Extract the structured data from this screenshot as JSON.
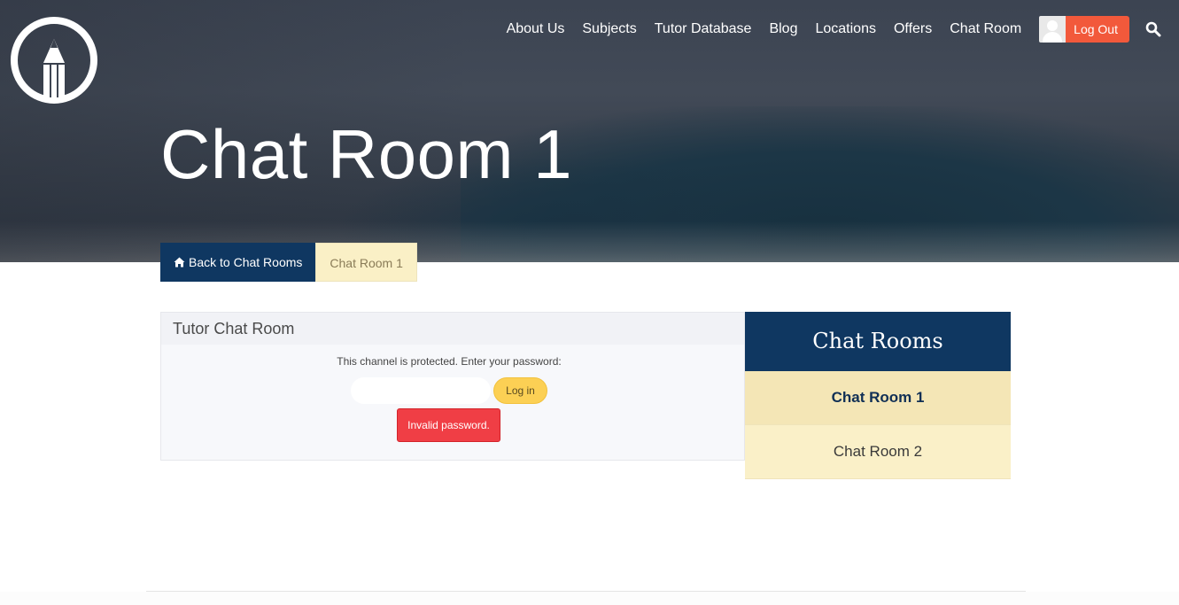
{
  "nav": {
    "items": [
      {
        "label": "About Us"
      },
      {
        "label": "Subjects"
      },
      {
        "label": "Tutor Database"
      },
      {
        "label": "Blog"
      },
      {
        "label": "Locations"
      },
      {
        "label": "Offers"
      },
      {
        "label": "Chat Room"
      }
    ],
    "logout_label": "Log Out",
    "search_icon": "search-icon",
    "avatar_icon": "user-avatar-icon"
  },
  "logo": {
    "icon": "pencil-circle-logo"
  },
  "hero": {
    "title": "Chat Room 1"
  },
  "breadcrumb": {
    "back_label": "Back to Chat Rooms",
    "back_icon": "home-icon",
    "current_label": "Chat Room 1"
  },
  "chat_panel": {
    "title": "Tutor Chat Room",
    "protected_message": "This channel is protected. Enter your password:",
    "password_value": "",
    "login_label": "Log in",
    "error_message": "Invalid password."
  },
  "rooms": {
    "heading": "Chat Rooms",
    "items": [
      {
        "label": "Chat Room 1",
        "active": true
      },
      {
        "label": "Chat Room 2",
        "active": false
      }
    ]
  },
  "colors": {
    "navy": "#0f3761",
    "cream": "#faf0c8",
    "logout": "#f2593b",
    "login": "#fcd054",
    "error": "#f03e45"
  }
}
